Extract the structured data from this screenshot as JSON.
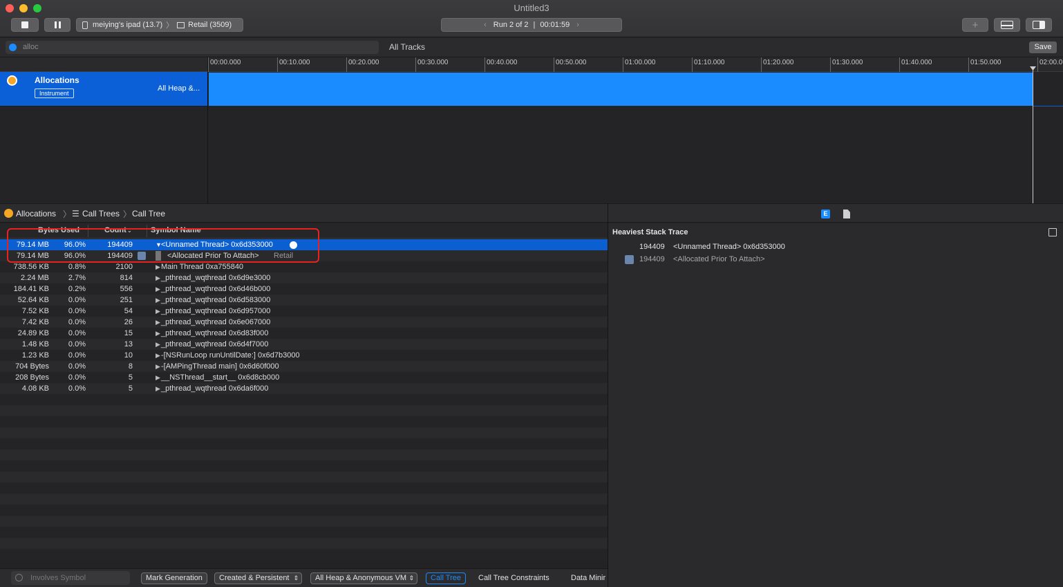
{
  "window": {
    "title": "Untitled3"
  },
  "toolbar": {
    "device": "meiying's ipad (13.7)",
    "target": "Retail (3509)",
    "run_label": "Run 2 of 2",
    "run_separator": "|",
    "run_time": "00:01:59"
  },
  "filter": {
    "value": "alloc",
    "tracks_label": "All Tracks",
    "save_label": "Save"
  },
  "timeline": {
    "ticks": [
      "00:00.000",
      "00:10.000",
      "00:20.000",
      "00:30.000",
      "00:40.000",
      "00:50.000",
      "01:00.000",
      "01:10.000",
      "01:20.000",
      "01:30.000",
      "01:40.000",
      "01:50.000",
      "02:00.0"
    ]
  },
  "track": {
    "name": "Allocations",
    "badge": "Instrument",
    "subtitle": "All Heap &..."
  },
  "breadcrumb": {
    "item1": "Allocations",
    "item2": "Call Trees",
    "item3": "Call Tree"
  },
  "table": {
    "headers": {
      "bytes": "Bytes Used",
      "count": "Count",
      "symbol": "Symbol Name"
    },
    "rows": [
      {
        "bytes": "79.14 MB",
        "pct": "96.0%",
        "count": "194409",
        "symbol": "<Unnamed Thread> 0x6d353000",
        "expander": "▼"
      },
      {
        "bytes": "79.14 MB",
        "pct": "96.0%",
        "count": "194409",
        "symbol": "<Allocated Prior To Attach>",
        "extra": "Retail",
        "expander": ""
      },
      {
        "bytes": "738.56 KB",
        "pct": "0.8%",
        "count": "2100",
        "symbol": "Main Thread  0xa755840",
        "expander": "▶"
      },
      {
        "bytes": "2.24 MB",
        "pct": "2.7%",
        "count": "814",
        "symbol": "_pthread_wqthread  0x6d9e3000",
        "expander": "▶"
      },
      {
        "bytes": "184.41 KB",
        "pct": "0.2%",
        "count": "556",
        "symbol": "_pthread_wqthread  0x6d46b000",
        "expander": "▶"
      },
      {
        "bytes": "52.64 KB",
        "pct": "0.0%",
        "count": "251",
        "symbol": "_pthread_wqthread  0x6d583000",
        "expander": "▶"
      },
      {
        "bytes": "7.52 KB",
        "pct": "0.0%",
        "count": "54",
        "symbol": "_pthread_wqthread  0x6d957000",
        "expander": "▶"
      },
      {
        "bytes": "7.42 KB",
        "pct": "0.0%",
        "count": "26",
        "symbol": "_pthread_wqthread  0x6e067000",
        "expander": "▶"
      },
      {
        "bytes": "24.89 KB",
        "pct": "0.0%",
        "count": "15",
        "symbol": "_pthread_wqthread  0x6d83f000",
        "expander": "▶"
      },
      {
        "bytes": "1.48 KB",
        "pct": "0.0%",
        "count": "13",
        "symbol": "_pthread_wqthread  0x6d4f7000",
        "expander": "▶"
      },
      {
        "bytes": "1.23 KB",
        "pct": "0.0%",
        "count": "10",
        "symbol": "-[NSRunLoop runUntilDate:]  0x6d7b3000",
        "expander": "▶"
      },
      {
        "bytes": "704 Bytes",
        "pct": "0.0%",
        "count": "8",
        "symbol": "-[AMPingThread main]  0x6d60f000",
        "expander": "▶"
      },
      {
        "bytes": "208 Bytes",
        "pct": "0.0%",
        "count": "5",
        "symbol": "__NSThread__start__  0x6d8cb000",
        "expander": "▶"
      },
      {
        "bytes": "4.08 KB",
        "pct": "0.0%",
        "count": "5",
        "symbol": "_pthread_wqthread  0x6da6f000",
        "expander": "▶"
      }
    ]
  },
  "inspector": {
    "title": "Heaviest Stack Trace",
    "frames": [
      {
        "count": "194409",
        "symbol": "<Unnamed Thread> 0x6d353000"
      },
      {
        "count": "194409",
        "symbol": "<Allocated Prior To Attach>"
      }
    ]
  },
  "bottom": {
    "search_placeholder": "Involves Symbol",
    "mark_generation": "Mark Generation",
    "lifespan": "Created & Persistent",
    "heap": "All Heap & Anonymous VM",
    "call_tree": "Call Tree",
    "constraints": "Call Tree Constraints",
    "data_mining": "Data Minir"
  },
  "colors": {
    "accent": "#1b8cff",
    "selection": "#0b5fd1",
    "highlight_box": "#e8231f"
  }
}
